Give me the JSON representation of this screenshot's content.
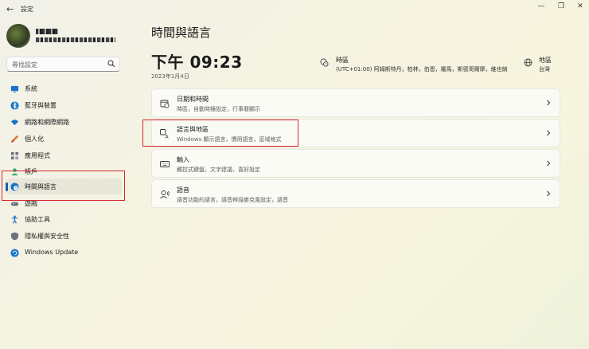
{
  "window": {
    "title": "設定",
    "back_glyph": "←",
    "controls": [
      "—",
      "❐",
      "✕"
    ]
  },
  "search": {
    "placeholder": "尋找設定"
  },
  "sidebar": {
    "items": [
      {
        "label": "系統",
        "icon": "monitor-icon",
        "color": "#1a73c9"
      },
      {
        "label": "藍牙與裝置",
        "icon": "bluetooth-icon",
        "color": "#1a73c9"
      },
      {
        "label": "網路和網際網路",
        "icon": "wifi-icon",
        "color": "#1a73c9"
      },
      {
        "label": "個人化",
        "icon": "brush-icon",
        "color": "#e07b2e"
      },
      {
        "label": "應用程式",
        "icon": "apps-icon",
        "color": "#6b7280"
      },
      {
        "label": "帳戶",
        "icon": "account-icon",
        "color": "#2eaa6a"
      },
      {
        "label": "時間與語言",
        "icon": "globe-clock-icon",
        "color": "#1a73c9",
        "active": true
      },
      {
        "label": "遊戲",
        "icon": "gamepad-icon",
        "color": "#6b7280"
      },
      {
        "label": "協助工具",
        "icon": "accessibility-icon",
        "color": "#1a73c9"
      },
      {
        "label": "隱私權與安全性",
        "icon": "shield-icon",
        "color": "#6b7280"
      },
      {
        "label": "Windows Update",
        "icon": "update-icon",
        "color": "#1a73c9"
      }
    ]
  },
  "main": {
    "title": "時間與語言",
    "time": "下午 09:23",
    "date": "2023年1月4日",
    "timezone": {
      "label": "時區",
      "value": "(UTC+01:00) 阿姆斯特丹，柏林，伯恩，羅馬，斯德哥爾摩，維也納"
    },
    "region": {
      "label": "地區",
      "value": "台灣"
    },
    "cards": [
      {
        "title": "日期和時間",
        "subtitle": "時區，自動時鐘設定，行事曆顯示",
        "icon": "calendar-clock-icon"
      },
      {
        "title": "語言與地區",
        "subtitle": "Windows 顯示語言，慣用語言，區域格式",
        "icon": "language-icon"
      },
      {
        "title": "輸入",
        "subtitle": "觸控式鍵盤，文字建議，喜好設定",
        "icon": "keyboard-icon"
      },
      {
        "title": "語音",
        "subtitle": "語音功能的語言，語音辨識麥克風設定，語音",
        "icon": "speech-icon"
      }
    ]
  },
  "colors": {
    "accent": "#1164a3",
    "highlight": "#d6262a"
  }
}
